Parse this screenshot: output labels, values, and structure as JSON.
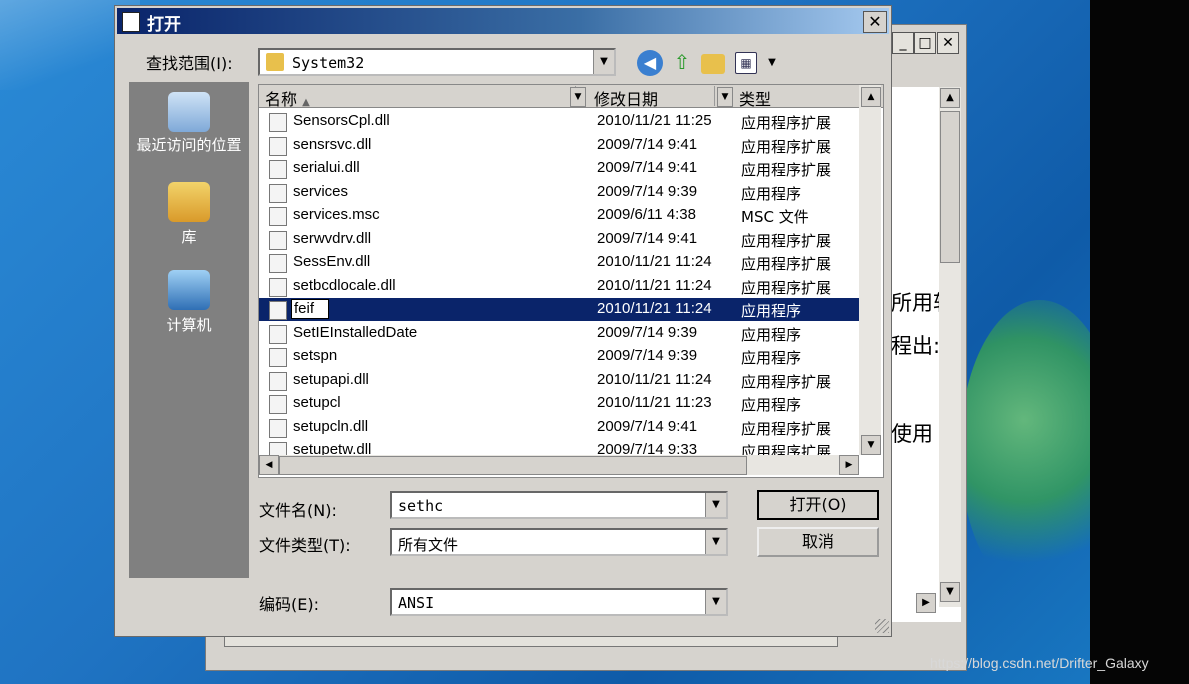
{
  "dialog": {
    "title": "打开",
    "close_glyph": "✕",
    "look_in_label": "查找范围(I):",
    "look_in_value": "System32",
    "places": [
      {
        "label": "最近访问的位置"
      },
      {
        "label": "库"
      },
      {
        "label": "计算机"
      }
    ],
    "columns": {
      "name": "名称",
      "date": "修改日期",
      "type": "类型"
    },
    "files": [
      {
        "name": "SensorsCpl.dll",
        "date": "2010/11/21 11:25",
        "type": "应用程序扩展"
      },
      {
        "name": "sensrsvc.dll",
        "date": "2009/7/14 9:41",
        "type": "应用程序扩展"
      },
      {
        "name": "serialui.dll",
        "date": "2009/7/14 9:41",
        "type": "应用程序扩展"
      },
      {
        "name": "services",
        "date": "2009/7/14 9:39",
        "type": "应用程序"
      },
      {
        "name": "services.msc",
        "date": "2009/6/11 4:38",
        "type": "MSC 文件"
      },
      {
        "name": "serwvdrv.dll",
        "date": "2009/7/14 9:41",
        "type": "应用程序扩展"
      },
      {
        "name": "SessEnv.dll",
        "date": "2010/11/21 11:24",
        "type": "应用程序扩展"
      },
      {
        "name": "setbcdlocale.dll",
        "date": "2010/11/21 11:24",
        "type": "应用程序扩展"
      },
      {
        "name": "feif",
        "date": "2010/11/21 11:24",
        "type": "应用程序",
        "selected": true
      },
      {
        "name": "SetIEInstalledDate",
        "date": "2009/7/14 9:39",
        "type": "应用程序"
      },
      {
        "name": "setspn",
        "date": "2009/7/14 9:39",
        "type": "应用程序"
      },
      {
        "name": "setupapi.dll",
        "date": "2010/11/21 11:24",
        "type": "应用程序扩展"
      },
      {
        "name": "setupcl",
        "date": "2010/11/21 11:23",
        "type": "应用程序"
      },
      {
        "name": "setupcln.dll",
        "date": "2009/7/14 9:41",
        "type": "应用程序扩展"
      },
      {
        "name": "setupetw.dll",
        "date": "2009/7/14 9:33",
        "type": "应用程序扩展"
      }
    ],
    "filename_label": "文件名(N):",
    "filename_value": "sethc",
    "filetype_label": "文件类型(T):",
    "filetype_value": "所有文件",
    "encoding_label": "编码(E):",
    "encoding_value": "ANSI",
    "open_button": "打开(O)",
    "cancel_button": "取消"
  },
  "background_window": {
    "min_glyph": "_",
    "max_glyph": "□",
    "close_glyph": "✕",
    "text_fragments": [
      "所用软",
      "程出:",
      "使用"
    ]
  },
  "watermark": "https://blog.csdn.net/Drifter_Galaxy",
  "colors": {
    "selection": "#0a246a",
    "title_start": "#0a246a",
    "title_end": "#a6caf0",
    "dialog_bg": "#d6d3ce"
  }
}
